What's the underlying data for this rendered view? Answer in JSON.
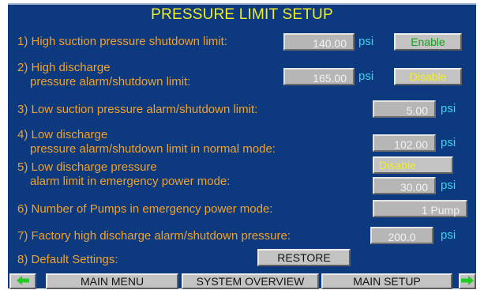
{
  "title": "PRESSURE LIMIT SETUP",
  "unit": "psi",
  "rows": {
    "r1": {
      "label": "1) High suction pressure shutdown limit:",
      "value": "140.00",
      "toggle": "Enable"
    },
    "r2": {
      "label_line1": "2) High discharge",
      "label_line2": "pressure alarm/shutdown limit:",
      "value": "165.00",
      "toggle": "Disable"
    },
    "r3": {
      "label": "3) Low suction pressure alarm/shutdown limit:",
      "value": "5.00"
    },
    "r4": {
      "label_line1": "4) Low discharge",
      "label_line2": "pressure alarm/shutdown limit in normal mode:",
      "value": "102.00"
    },
    "r5": {
      "label_line1": "5) Low discharge pressure",
      "label_line2": "alarm limit in emergency power mode:",
      "toggle": "Disable",
      "value": "30.00"
    },
    "r6": {
      "label": "6) Number of Pumps in emergency power mode:",
      "value": "1 Pump"
    },
    "r7": {
      "label": "7) Factory high discharge alarm/shutdown pressure:",
      "value": "200.0"
    },
    "r8": {
      "label": "8) Default Settings:",
      "button": "RESTORE"
    }
  },
  "nav": {
    "main_menu": "MAIN MENU",
    "system_overview": "SYSTEM OVERVIEW",
    "main_setup": "MAIN SETUP",
    "left_icon": "arrow-left-icon",
    "right_icon": "arrow-right-icon"
  },
  "colors": {
    "background": "#0d3a7e",
    "title": "#f1ef24",
    "label": "#f0a12b",
    "unit": "#38d4f2",
    "enable": "#16a316",
    "disable": "#f1ef24",
    "arrow": "#22cc22"
  }
}
